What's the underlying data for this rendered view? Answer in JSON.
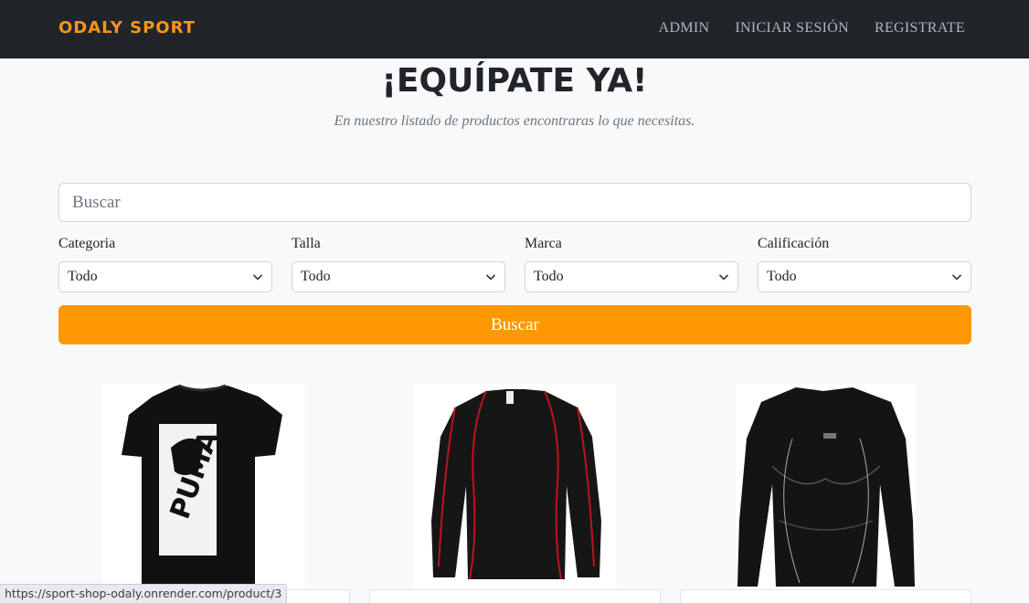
{
  "navbar": {
    "brand": "ODALY SPORT",
    "links": [
      "ADMIN",
      "INICIAR SESIÓN",
      "REGISTRATE"
    ]
  },
  "hero": {
    "title": "¡EQUÍPATE YA!",
    "subtitle": "En nuestro listado de productos encontraras lo que necesitas."
  },
  "search": {
    "placeholder": "Buscar"
  },
  "filters": [
    {
      "label": "Categoria",
      "selected": "Todo"
    },
    {
      "label": "Talla",
      "selected": "Todo"
    },
    {
      "label": "Marca",
      "selected": "Todo"
    },
    {
      "label": "Calificación",
      "selected": "Todo"
    }
  ],
  "search_button": "Buscar",
  "products": [
    {
      "image": "black-puma-tshirt"
    },
    {
      "image": "black-red-compression-shirt"
    },
    {
      "image": "black-compression-longsleeve"
    }
  ],
  "status_bar": "https://sport-shop-odaly.onrender.com/product/3",
  "colors": {
    "navbar_bg": "#212529",
    "brand": "#f7941d",
    "accent_button": "#ff9800",
    "page_bg": "#f8f9fa"
  }
}
